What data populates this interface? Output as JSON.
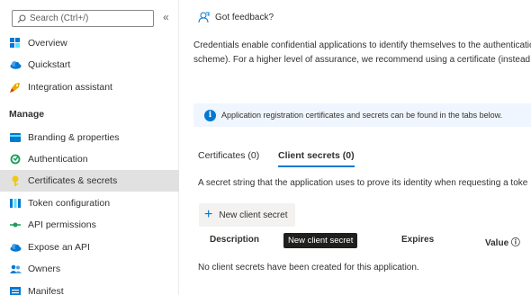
{
  "sidebar": {
    "search_placeholder": "Search (Ctrl+/)",
    "collapse_label": "«",
    "section_manage": "Manage",
    "items": [
      {
        "label": "Overview",
        "icon": "grid-icon"
      },
      {
        "label": "Quickstart",
        "icon": "cloud-icon"
      },
      {
        "label": "Integration assistant",
        "icon": "rocket-icon"
      },
      {
        "label": "Branding & properties",
        "icon": "card-icon"
      },
      {
        "label": "Authentication",
        "icon": "loop-icon"
      },
      {
        "label": "Certificates & secrets",
        "icon": "key-icon"
      },
      {
        "label": "Token configuration",
        "icon": "bars-icon"
      },
      {
        "label": "API permissions",
        "icon": "api-icon"
      },
      {
        "label": "Expose an API",
        "icon": "cloud-icon"
      },
      {
        "label": "Owners",
        "icon": "people-icon"
      },
      {
        "label": "Manifest",
        "icon": "manifest-icon"
      }
    ]
  },
  "main": {
    "feedback_label": "Got feedback?",
    "description_line1": "Credentials enable confidential applications to identify themselves to the authenticatio",
    "description_line2": "scheme). For a higher level of assurance, we recommend using a certificate (instead of",
    "info_text": "Application registration certificates and secrets can be found in the tabs below.",
    "tabs": [
      {
        "label": "Certificates (0)",
        "active": false
      },
      {
        "label": "Client secrets (0)",
        "active": true
      }
    ],
    "secret_description": "A secret string that the application uses to prove its identity when requesting a toke",
    "new_secret_button": "New client secret",
    "tooltip": "New client secret",
    "columns": [
      "Description",
      "Expires",
      "Value ⓘ"
    ],
    "empty_message": "No client secrets have been created for this application."
  },
  "colors": {
    "accent": "#0078d4",
    "selected_bg": "#e1e1e1",
    "info_bg": "#f0f6ff"
  }
}
